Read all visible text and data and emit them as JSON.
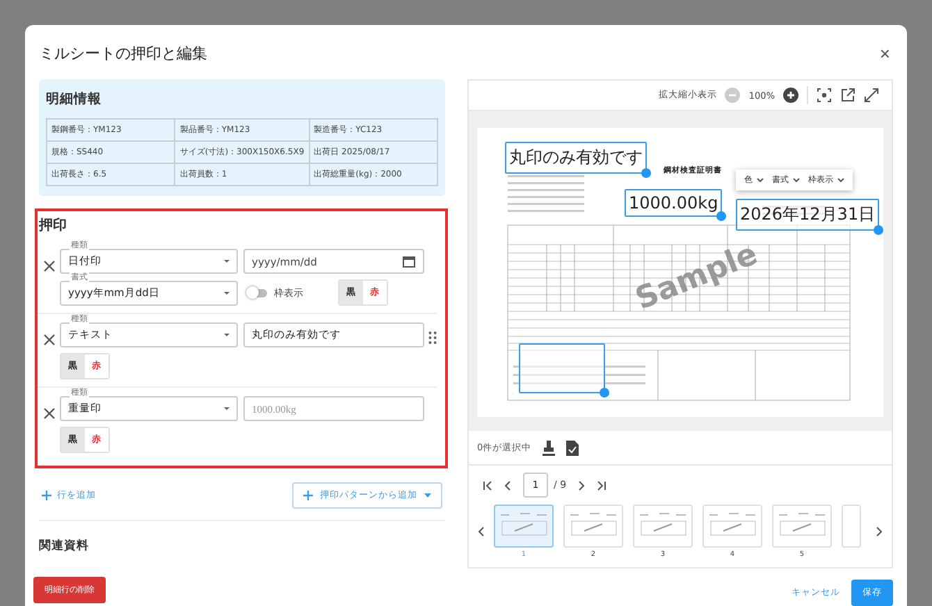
{
  "dialog": {
    "title": "ミルシートの押印と編集",
    "close": "×"
  },
  "details": {
    "title": "明細情報",
    "cells": [
      "製鋼番号：YM123",
      "製品番号：YM123",
      "製造番号：YC123",
      "規格：SS440",
      "サイズ(寸法)：300X150X6.5X9",
      "出荷日 2025/08/17",
      "出荷長さ：6.5",
      "出荷員数：1",
      "出荷総重量(kg)：2000"
    ]
  },
  "stamps": {
    "title": "押印",
    "rows": [
      {
        "kind": "date",
        "type_label": "種類",
        "type_value": "日付印",
        "placeholder": "yyyy/mm/dd",
        "format_label": "書式",
        "format_value": "yyyy年mm月dd日",
        "frame_label": "枠表示",
        "frame_on": false,
        "hovered": false,
        "colors": [
          {
            "label": "黒",
            "selected": true
          },
          {
            "label": "赤",
            "selected": false
          }
        ]
      },
      {
        "kind": "text",
        "type_label": "種類",
        "type_value": "テキスト",
        "value": "丸印のみ有効です",
        "hovered": true,
        "colors": [
          {
            "label": "黒",
            "selected": true
          },
          {
            "label": "赤",
            "selected": false
          }
        ]
      },
      {
        "kind": "weight",
        "type_label": "種類",
        "type_value": "重量印",
        "placeholder": "1000.00kg",
        "hovered": false,
        "colors": [
          {
            "label": "黒",
            "selected": true
          },
          {
            "label": "赤",
            "selected": false
          }
        ]
      }
    ]
  },
  "add_row": "行を追加",
  "add_pattern": "押印パターンから追加",
  "related_title": "関連資料",
  "delete_button": "明細行の削除",
  "preview": {
    "zoom_label": "拡大縮小表示",
    "zoom_value": "100%",
    "doc_title": "鋼材検査証明書",
    "watermark": "Sample",
    "overlays": [
      {
        "text": "丸印のみ有効です"
      },
      {
        "text": "1000.00kg"
      },
      {
        "text": "2026年12月31日"
      },
      {
        "kind": "frame"
      }
    ],
    "menu": [
      "色",
      "書式",
      "枠表示"
    ],
    "selection": "0件が選択中",
    "page": "1",
    "page_total": "/ 9",
    "thumbs": [
      {
        "label": "1",
        "selected": true
      },
      {
        "label": "2",
        "selected": false
      },
      {
        "label": "3",
        "selected": false
      },
      {
        "label": "4",
        "selected": false
      },
      {
        "label": "5",
        "selected": false
      }
    ]
  },
  "footer": {
    "cancel": "キャンセル",
    "save": "保存"
  }
}
